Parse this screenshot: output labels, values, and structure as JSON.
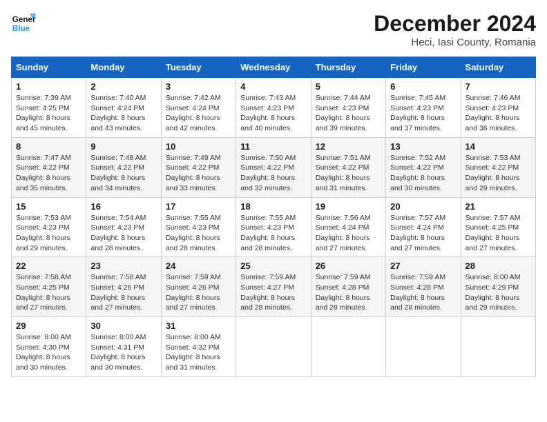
{
  "logo": {
    "line1": "General",
    "line2": "Blue"
  },
  "title": "December 2024",
  "subtitle": "Heci, Iasi County, Romania",
  "days_of_week": [
    "Sunday",
    "Monday",
    "Tuesday",
    "Wednesday",
    "Thursday",
    "Friday",
    "Saturday"
  ],
  "weeks": [
    [
      {
        "day": "1",
        "sunrise": "7:39 AM",
        "sunset": "4:25 PM",
        "daylight": "8 hours and 45 minutes."
      },
      {
        "day": "2",
        "sunrise": "7:40 AM",
        "sunset": "4:24 PM",
        "daylight": "8 hours and 43 minutes."
      },
      {
        "day": "3",
        "sunrise": "7:42 AM",
        "sunset": "4:24 PM",
        "daylight": "8 hours and 42 minutes."
      },
      {
        "day": "4",
        "sunrise": "7:43 AM",
        "sunset": "4:23 PM",
        "daylight": "8 hours and 40 minutes."
      },
      {
        "day": "5",
        "sunrise": "7:44 AM",
        "sunset": "4:23 PM",
        "daylight": "8 hours and 39 minutes."
      },
      {
        "day": "6",
        "sunrise": "7:45 AM",
        "sunset": "4:23 PM",
        "daylight": "8 hours and 37 minutes."
      },
      {
        "day": "7",
        "sunrise": "7:46 AM",
        "sunset": "4:23 PM",
        "daylight": "8 hours and 36 minutes."
      }
    ],
    [
      {
        "day": "8",
        "sunrise": "7:47 AM",
        "sunset": "4:22 PM",
        "daylight": "8 hours and 35 minutes."
      },
      {
        "day": "9",
        "sunrise": "7:48 AM",
        "sunset": "4:22 PM",
        "daylight": "8 hours and 34 minutes."
      },
      {
        "day": "10",
        "sunrise": "7:49 AM",
        "sunset": "4:22 PM",
        "daylight": "8 hours and 33 minutes."
      },
      {
        "day": "11",
        "sunrise": "7:50 AM",
        "sunset": "4:22 PM",
        "daylight": "8 hours and 32 minutes."
      },
      {
        "day": "12",
        "sunrise": "7:51 AM",
        "sunset": "4:22 PM",
        "daylight": "8 hours and 31 minutes."
      },
      {
        "day": "13",
        "sunrise": "7:52 AM",
        "sunset": "4:22 PM",
        "daylight": "8 hours and 30 minutes."
      },
      {
        "day": "14",
        "sunrise": "7:53 AM",
        "sunset": "4:22 PM",
        "daylight": "8 hours and 29 minutes."
      }
    ],
    [
      {
        "day": "15",
        "sunrise": "7:53 AM",
        "sunset": "4:23 PM",
        "daylight": "8 hours and 29 minutes."
      },
      {
        "day": "16",
        "sunrise": "7:54 AM",
        "sunset": "4:23 PM",
        "daylight": "8 hours and 28 minutes."
      },
      {
        "day": "17",
        "sunrise": "7:55 AM",
        "sunset": "4:23 PM",
        "daylight": "8 hours and 28 minutes."
      },
      {
        "day": "18",
        "sunrise": "7:55 AM",
        "sunset": "4:23 PM",
        "daylight": "8 hours and 28 minutes."
      },
      {
        "day": "19",
        "sunrise": "7:56 AM",
        "sunset": "4:24 PM",
        "daylight": "8 hours and 27 minutes."
      },
      {
        "day": "20",
        "sunrise": "7:57 AM",
        "sunset": "4:24 PM",
        "daylight": "8 hours and 27 minutes."
      },
      {
        "day": "21",
        "sunrise": "7:57 AM",
        "sunset": "4:25 PM",
        "daylight": "8 hours and 27 minutes."
      }
    ],
    [
      {
        "day": "22",
        "sunrise": "7:58 AM",
        "sunset": "4:25 PM",
        "daylight": "8 hours and 27 minutes."
      },
      {
        "day": "23",
        "sunrise": "7:58 AM",
        "sunset": "4:26 PM",
        "daylight": "8 hours and 27 minutes."
      },
      {
        "day": "24",
        "sunrise": "7:59 AM",
        "sunset": "4:26 PM",
        "daylight": "8 hours and 27 minutes."
      },
      {
        "day": "25",
        "sunrise": "7:59 AM",
        "sunset": "4:27 PM",
        "daylight": "8 hours and 28 minutes."
      },
      {
        "day": "26",
        "sunrise": "7:59 AM",
        "sunset": "4:28 PM",
        "daylight": "8 hours and 28 minutes."
      },
      {
        "day": "27",
        "sunrise": "7:59 AM",
        "sunset": "4:28 PM",
        "daylight": "8 hours and 28 minutes."
      },
      {
        "day": "28",
        "sunrise": "8:00 AM",
        "sunset": "4:29 PM",
        "daylight": "8 hours and 29 minutes."
      }
    ],
    [
      {
        "day": "29",
        "sunrise": "8:00 AM",
        "sunset": "4:30 PM",
        "daylight": "8 hours and 30 minutes."
      },
      {
        "day": "30",
        "sunrise": "8:00 AM",
        "sunset": "4:31 PM",
        "daylight": "8 hours and 30 minutes."
      },
      {
        "day": "31",
        "sunrise": "8:00 AM",
        "sunset": "4:32 PM",
        "daylight": "8 hours and 31 minutes."
      },
      null,
      null,
      null,
      null
    ]
  ]
}
